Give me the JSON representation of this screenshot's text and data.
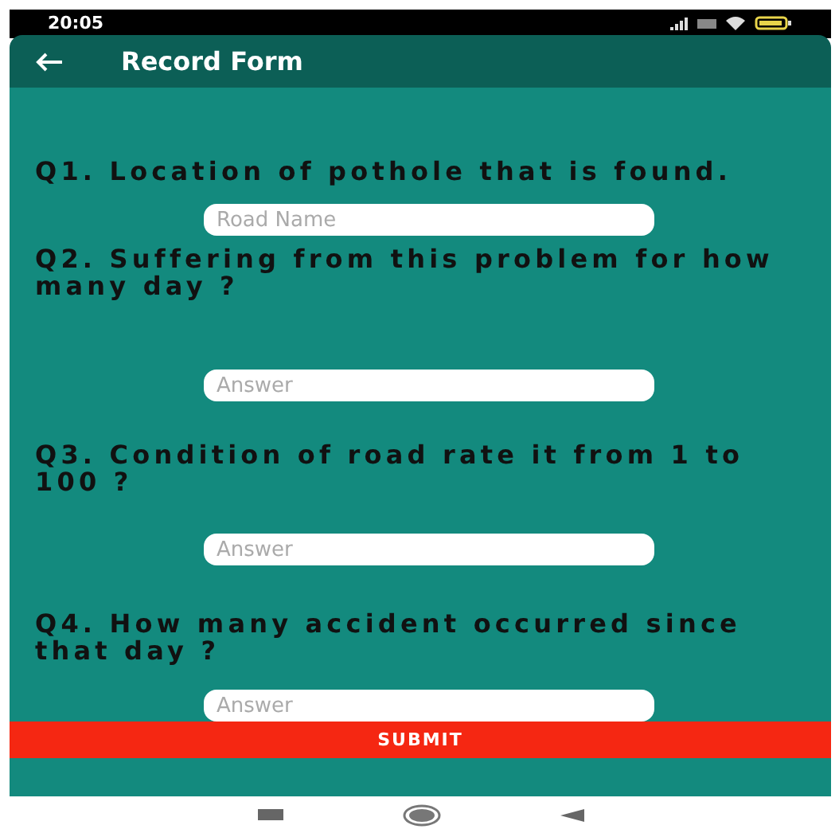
{
  "status_bar": {
    "time": "20:05"
  },
  "app_bar": {
    "title": "Record Form"
  },
  "questions": [
    {
      "label": "Q1. Location of pothole that is found.",
      "placeholder": "Road Name"
    },
    {
      "label": "Q2. Suffering from this problem for how many day ?",
      "placeholder": "Answer"
    },
    {
      "label": "Q3. Condition of road rate it from 1 to 100 ?",
      "placeholder": "Answer"
    },
    {
      "label": "Q4. How many accident occurred since that day ?",
      "placeholder": "Answer"
    }
  ],
  "submit_button": {
    "label": "SUBMIT"
  }
}
